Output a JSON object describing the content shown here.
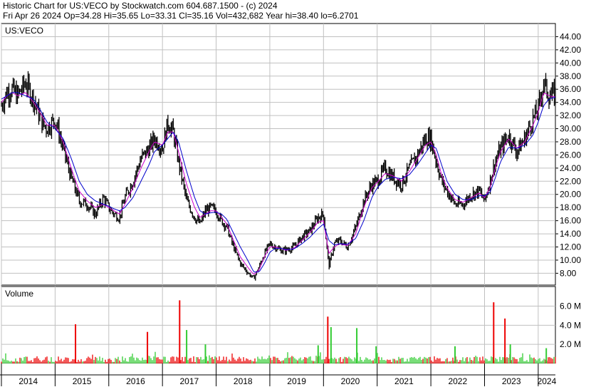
{
  "header": {
    "line1": "Historic Chart for US:VECO by Stockwatch.com 604.687.1500 - (c) 2024",
    "line2": "Fri Apr 26 2024   Op=34.28   Hi=35.65   Lo=33.31   Cl=35.16   Vol=432,682   Year hi=38.40   lo=6.2701"
  },
  "chart_data": [
    {
      "type": "line",
      "panel": "price",
      "title": "US:VECO",
      "ylim": [
        6.2,
        46.0
      ],
      "y_ticks": [
        "44.00",
        "42.00",
        "40.00",
        "38.00",
        "36.00",
        "34.00",
        "32.00",
        "30.00",
        "28.00",
        "26.00",
        "24.00",
        "22.00",
        "20.00",
        "18.00",
        "16.00",
        "14.00",
        "12.00",
        "10.00",
        "8.00"
      ],
      "grid": true,
      "colors": {
        "price": "#000000",
        "ma_short": "#cc00cc",
        "ma_long": "#0000cc",
        "grid": "#c0c0c0"
      },
      "x": [
        2014.0,
        2014.1,
        2014.2,
        2014.3,
        2014.45,
        2014.6,
        2014.75,
        2014.85,
        2015.0,
        2015.15,
        2015.3,
        2015.45,
        2015.6,
        2015.75,
        2015.9,
        2016.0,
        2016.1,
        2016.2,
        2016.3,
        2016.45,
        2016.6,
        2016.75,
        2016.85,
        2017.0,
        2017.1,
        2017.2,
        2017.3,
        2017.45,
        2017.6,
        2017.7,
        2017.8,
        2017.9,
        2018.0,
        2018.1,
        2018.2,
        2018.3,
        2018.45,
        2018.6,
        2018.7,
        2018.8,
        2018.9,
        2019.0,
        2019.1,
        2019.2,
        2019.3,
        2019.45,
        2019.6,
        2019.75,
        2019.9,
        2020.0,
        2020.1,
        2020.2,
        2020.3,
        2020.45,
        2020.6,
        2020.75,
        2020.9,
        2021.0,
        2021.15,
        2021.3,
        2021.45,
        2021.6,
        2021.75,
        2021.9,
        2022.0,
        2022.1,
        2022.2,
        2022.3,
        2022.45,
        2022.6,
        2022.75,
        2022.9,
        2023.0,
        2023.1,
        2023.2,
        2023.3,
        2023.45,
        2023.6,
        2023.75,
        2023.9,
        2024.0,
        2024.1,
        2024.2,
        2024.32
      ],
      "series": [
        {
          "key": "close",
          "values": [
            33.5,
            35.5,
            36.0,
            35.0,
            37.0,
            34.5,
            31.0,
            30.0,
            31.5,
            27.0,
            22.5,
            19.0,
            18.5,
            17.0,
            19.5,
            18.0,
            17.0,
            16.5,
            19.5,
            22.0,
            25.5,
            27.0,
            28.5,
            27.0,
            31.0,
            29.5,
            25.0,
            19.0,
            16.5,
            15.5,
            17.5,
            18.0,
            17.5,
            16.0,
            15.0,
            12.5,
            9.5,
            8.0,
            7.2,
            9.0,
            11.0,
            12.5,
            12.0,
            11.5,
            11.5,
            12.0,
            13.5,
            14.5,
            16.5,
            17.0,
            9.0,
            12.5,
            13.0,
            12.0,
            15.0,
            19.0,
            21.5,
            22.0,
            24.0,
            22.5,
            21.5,
            24.0,
            26.0,
            28.5,
            28.5,
            25.0,
            22.0,
            20.5,
            18.5,
            18.5,
            20.0,
            20.5,
            19.0,
            22.0,
            25.0,
            27.0,
            29.0,
            26.5,
            28.5,
            31.5,
            33.0,
            37.0,
            35.0,
            35.16
          ]
        },
        {
          "key": "ma_short",
          "values": [
            34.0,
            35.0,
            35.5,
            35.0,
            35.5,
            34.0,
            32.0,
            30.5,
            30.5,
            28.0,
            24.0,
            20.5,
            19.0,
            18.0,
            18.5,
            18.0,
            17.5,
            17.0,
            18.5,
            21.0,
            24.0,
            26.5,
            28.0,
            27.5,
            29.5,
            29.5,
            26.5,
            21.5,
            18.0,
            16.5,
            17.0,
            17.5,
            17.5,
            16.5,
            15.5,
            13.5,
            10.5,
            8.8,
            7.8,
            8.5,
            10.5,
            12.0,
            12.0,
            11.8,
            11.5,
            11.8,
            13.0,
            14.2,
            15.8,
            16.0,
            11.0,
            12.0,
            12.5,
            12.2,
            14.0,
            18.0,
            21.0,
            21.8,
            23.2,
            22.8,
            22.0,
            23.5,
            25.5,
            27.5,
            28.0,
            26.0,
            23.0,
            21.0,
            19.2,
            18.8,
            19.5,
            20.2,
            19.5,
            21.0,
            24.0,
            26.5,
            28.5,
            27.0,
            28.0,
            30.5,
            32.5,
            35.5,
            35.0,
            34.8
          ]
        },
        {
          "key": "ma_long",
          "values": [
            34.5,
            35.0,
            35.5,
            35.5,
            35.0,
            34.5,
            32.5,
            31.0,
            30.0,
            28.5,
            25.5,
            22.0,
            20.0,
            19.0,
            18.5,
            18.2,
            17.8,
            17.5,
            18.0,
            19.5,
            22.0,
            24.5,
            26.5,
            27.5,
            28.5,
            29.5,
            28.0,
            23.5,
            19.5,
            17.5,
            17.0,
            17.2,
            17.3,
            17.0,
            16.2,
            14.5,
            12.0,
            9.8,
            8.2,
            8.2,
            9.5,
            11.2,
            11.8,
            11.8,
            11.6,
            11.7,
            12.5,
            13.5,
            14.8,
            15.5,
            13.0,
            12.3,
            12.5,
            12.4,
            13.3,
            16.0,
            19.5,
            21.0,
            22.3,
            22.6,
            22.4,
            23.0,
            24.5,
            26.3,
            27.5,
            27.0,
            24.5,
            22.0,
            20.0,
            19.2,
            19.2,
            19.8,
            19.8,
            20.3,
            22.5,
            25.0,
            27.2,
            27.0,
            27.5,
            29.0,
            31.0,
            33.5,
            34.5,
            34.8
          ]
        }
      ]
    },
    {
      "type": "bar",
      "panel": "volume",
      "title": "Volume",
      "ylim": [
        0,
        7.6
      ],
      "y_ticks": [
        "6.0 M",
        "4.0 M",
        "2.0 M"
      ],
      "unit": "M",
      "grid": true,
      "colors": {
        "up": "#33cc33",
        "down": "#ee0000"
      },
      "baseline_range": [
        0.15,
        0.75
      ],
      "spikes": [
        {
          "x": 2015.38,
          "value": 4.1,
          "dir": "down"
        },
        {
          "x": 2016.72,
          "value": 3.3,
          "dir": "down"
        },
        {
          "x": 2017.32,
          "value": 6.6,
          "dir": "down"
        },
        {
          "x": 2017.45,
          "value": 3.5,
          "dir": "up"
        },
        {
          "x": 2017.8,
          "value": 2.0,
          "dir": "up"
        },
        {
          "x": 2019.9,
          "value": 1.9,
          "dir": "up"
        },
        {
          "x": 2020.08,
          "value": 4.9,
          "dir": "down"
        },
        {
          "x": 2020.14,
          "value": 3.8,
          "dir": "up"
        },
        {
          "x": 2020.62,
          "value": 3.7,
          "dir": "up"
        },
        {
          "x": 2020.98,
          "value": 1.8,
          "dir": "up"
        },
        {
          "x": 2022.45,
          "value": 1.8,
          "dir": "up"
        },
        {
          "x": 2023.17,
          "value": 6.4,
          "dir": "down"
        },
        {
          "x": 2023.38,
          "value": 4.7,
          "dir": "down"
        },
        {
          "x": 2023.48,
          "value": 2.0,
          "dir": "up"
        },
        {
          "x": 2024.15,
          "value": 1.6,
          "dir": "up"
        }
      ]
    },
    {
      "type": "axis",
      "panel": "x-axis",
      "x_labels": [
        "2014",
        "2015",
        "2016",
        "2017",
        "2018",
        "2019",
        "2020",
        "2021",
        "2022",
        "2023",
        "2024"
      ],
      "x_boundaries": [
        2014.0,
        2015.0,
        2016.0,
        2017.0,
        2018.0,
        2019.0,
        2020.0,
        2021.0,
        2022.0,
        2023.0,
        2024.0
      ],
      "x_range": [
        2014.0,
        2024.32
      ]
    }
  ]
}
